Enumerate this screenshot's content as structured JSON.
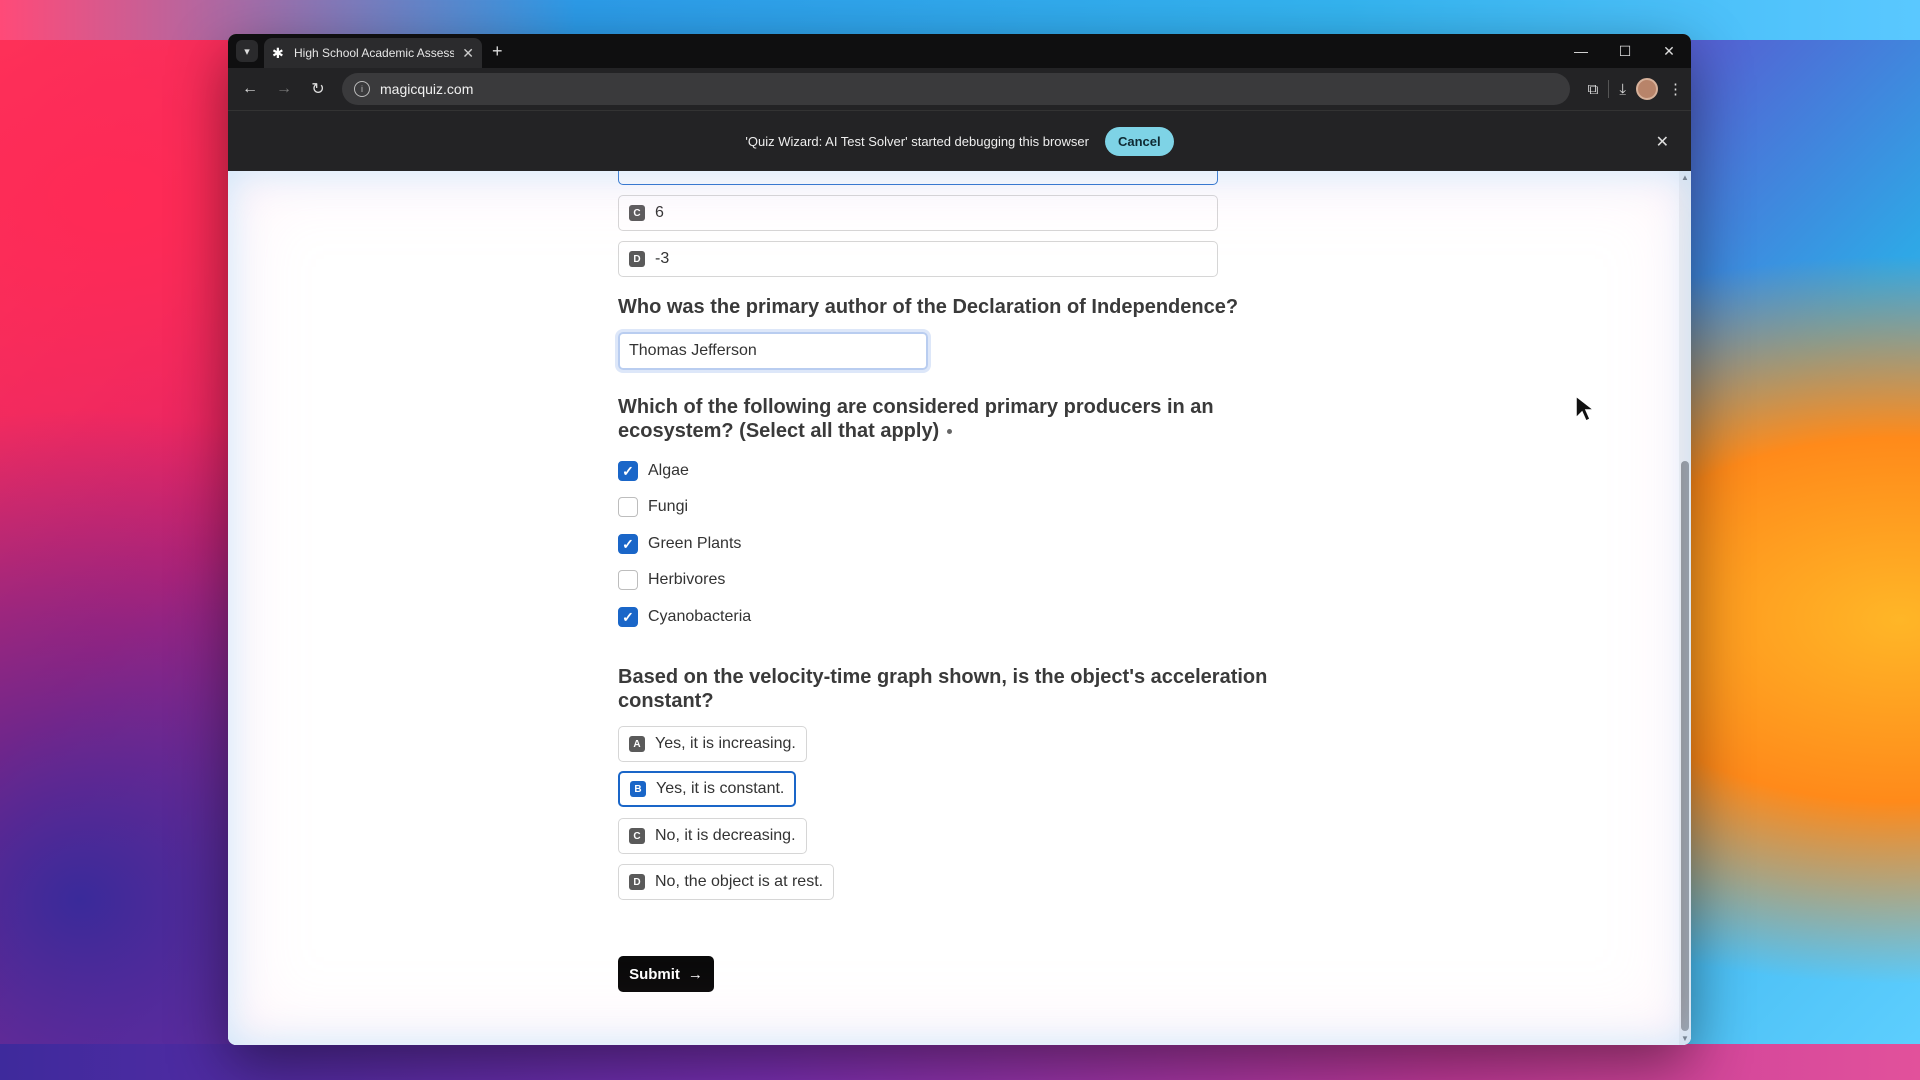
{
  "browser": {
    "tab_title": "High School Academic Assessm",
    "url": "magicquiz.com",
    "new_tab_symbol": "+",
    "icons": [
      "tab-list-icon",
      "close-tab-icon",
      "back-icon",
      "forward-icon",
      "reload-icon",
      "site-info-icon",
      "extension-icon",
      "download-icon",
      "profile-avatar",
      "more-menu-icon",
      "minimize-icon",
      "maximize-icon",
      "close-window-icon"
    ]
  },
  "debug_bar": {
    "message": "'Quiz Wizard: AI Test Solver' started debugging this browser",
    "cancel_label": "Cancel"
  },
  "quiz": {
    "prev_question_options": [
      {
        "letter": "C",
        "text": "6"
      },
      {
        "letter": "D",
        "text": "-3"
      }
    ],
    "q_author": {
      "text": "Who was the primary author of the Declaration of Independence?",
      "answer": "Thomas Jefferson"
    },
    "q_producers": {
      "text": "Which of the following are considered primary producers in an ecosystem? (Select all that apply)",
      "options": [
        {
          "label": "Algae",
          "checked": true
        },
        {
          "label": "Fungi",
          "checked": false
        },
        {
          "label": "Green Plants",
          "checked": true
        },
        {
          "label": "Herbivores",
          "checked": false
        },
        {
          "label": "Cyanobacteria",
          "checked": true
        }
      ]
    },
    "q_velocity": {
      "text": "Based on the velocity-time graph shown, is the object's acceleration constant?",
      "options": [
        {
          "letter": "A",
          "text": "Yes, it is increasing.",
          "selected": false
        },
        {
          "letter": "B",
          "text": "Yes, it is constant.",
          "selected": true
        },
        {
          "letter": "C",
          "text": "No, it is decreasing.",
          "selected": false
        },
        {
          "letter": "D",
          "text": "No, the object is at rest.",
          "selected": false
        }
      ]
    },
    "submit_label": "Submit"
  },
  "colors": {
    "accent": "#1a66c8",
    "debug_cancel": "#7ed3e6"
  }
}
